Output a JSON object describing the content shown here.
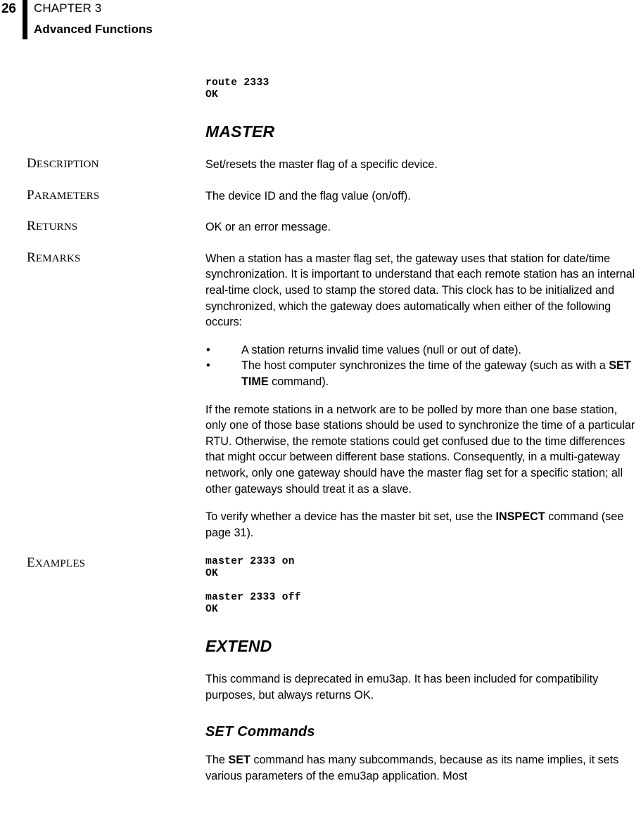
{
  "header": {
    "page_number": "26",
    "chapter_label": "CHAPTER 3",
    "chapter_title": "Advanced Functions"
  },
  "top_code": {
    "text": "route 2333\nOK"
  },
  "master_section": {
    "heading": "MASTER",
    "labels": {
      "description": "DESCRIPTION",
      "parameters": "PARAMETERS",
      "returns": "RETURNS",
      "remarks": "REMARKS",
      "examples": "EXAMPLES"
    },
    "description_text": "Set/resets the master flag of a specific device.",
    "parameters_text": "The device ID and the flag value (on/off).",
    "returns_text": "OK or an error message.",
    "remarks_p1": "When a station has a master flag set, the gateway uses that station for date/time synchronization. It is important to understand that each remote station has an internal real-time clock, used to stamp the stored data. This clock has to be initialized and synchronized, which the gateway does automatically when either of the following occurs:",
    "bullets": [
      {
        "marker": "•",
        "text_before": "A station returns invalid time values (null or out of date).",
        "bold": "",
        "text_after": ""
      },
      {
        "marker": "•",
        "text_before": "The host computer synchronizes the time of the gateway (such as with a ",
        "bold": "SET TIME",
        "text_after": " command)."
      }
    ],
    "remarks_p2": "If the remote stations in a network are to be polled by more than one base station, only one of those base stations should be used to synchronize the time of a particular RTU. Otherwise, the remote stations could get confused due to the time differences that might occur between different base stations. Consequently, in a multi-gateway network, only one gateway should have the master flag set for a specific station; all other gateways should treat it as a slave.",
    "remarks_p3_before": "To verify whether a device has the master bit set, use the ",
    "remarks_p3_bold": "INSPECT",
    "remarks_p3_after": " command (see page 31).",
    "examples_code_1": "master 2333 on\nOK",
    "examples_code_2": "master 2333 off\nOK"
  },
  "extend_section": {
    "heading": "EXTEND",
    "paragraph": "This command is deprecated in emu3ap. It has been included for compatibility purposes, but always returns OK."
  },
  "set_section": {
    "heading": "SET Commands",
    "paragraph_before": "The ",
    "paragraph_bold": "SET",
    "paragraph_after": " command has many subcommands, because as its name implies, it sets various parameters of the emu3ap application. Most"
  }
}
